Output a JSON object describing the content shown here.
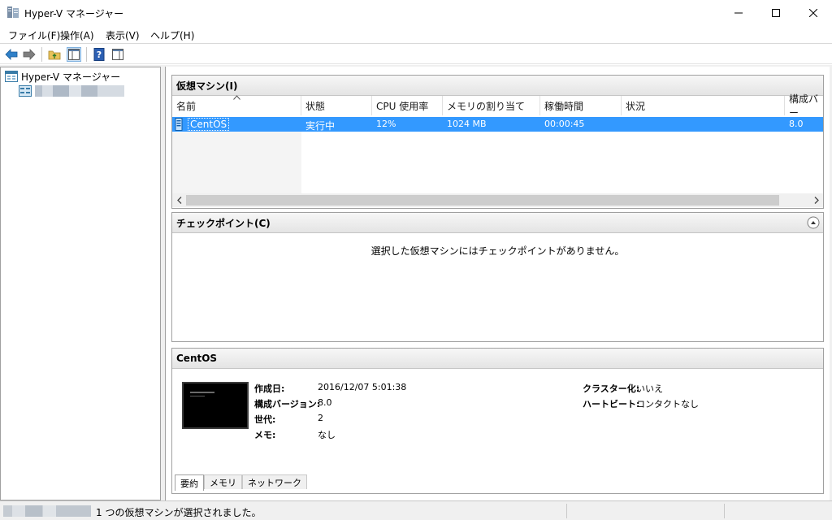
{
  "window": {
    "title": "Hyper-V マネージャー",
    "icon": "hyperv-server-icon"
  },
  "menu": {
    "items": [
      "ファイル(F)",
      "操作(A)",
      "表示(V)",
      "ヘルプ(H)"
    ]
  },
  "toolbar": {
    "icons": [
      "back-arrow-icon",
      "forward-arrow-icon",
      "up-folder-icon",
      "show-hide-tree-icon",
      "help-icon",
      "show-hide-action-pane-icon"
    ]
  },
  "nav": {
    "root_label": "Hyper-V マネージャー"
  },
  "vm_section": {
    "title": "仮想マシン(I)",
    "columns": [
      "名前",
      "状態",
      "CPU 使用率",
      "メモリの割り当て",
      "稼働時間",
      "状況",
      "構成バー"
    ],
    "rows": [
      {
        "name": "CentOS",
        "state": "実行中",
        "cpu": "12%",
        "memory": "1024 MB",
        "uptime": "00:00:45",
        "status": "",
        "version": "8.0"
      }
    ]
  },
  "checkpoint_section": {
    "title": "チェックポイント(C)",
    "empty_message": "選択した仮想マシンにはチェックポイントがありません。"
  },
  "details_section": {
    "title": "CentOS",
    "fields_left": [
      {
        "label": "作成日:",
        "value": "2016/12/07 5:01:38"
      },
      {
        "label": "構成バージョン:",
        "value": "8.0"
      },
      {
        "label": "世代:",
        "value": "2"
      },
      {
        "label": "メモ:",
        "value": "なし"
      }
    ],
    "fields_right": [
      {
        "label": "クラスター化:",
        "value": "いいえ"
      },
      {
        "label": "ハートビート:",
        "value": "コンタクトなし"
      }
    ],
    "tabs": [
      "要約",
      "メモリ",
      "ネットワーク"
    ]
  },
  "statusbar": {
    "message": "1 つの仮想マシンが選択されました。"
  },
  "colors": {
    "selection": "#3399ff",
    "header_gradient_top": "#f7f7f7",
    "header_gradient_bottom": "#e4e4e4"
  }
}
